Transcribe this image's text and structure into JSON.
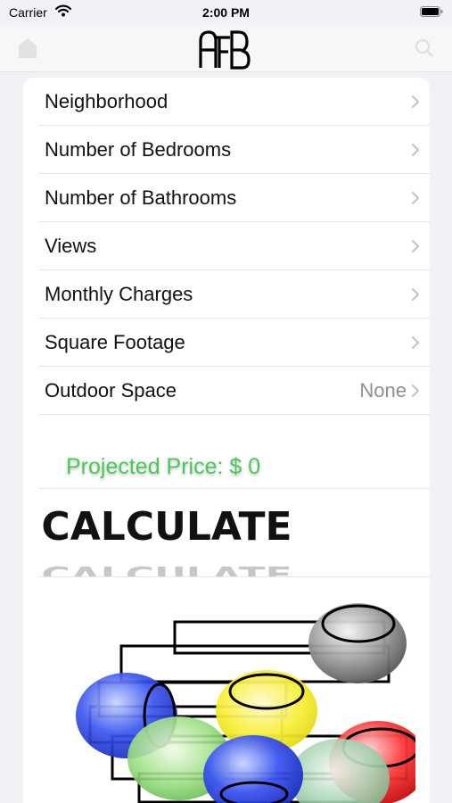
{
  "status_bar": {
    "carrier": "Carrier",
    "time": "2:00 PM",
    "icons": [
      "wifi-icon",
      "battery-icon"
    ]
  },
  "nav": {
    "logo_text": "AFB",
    "icons": [
      "home-icon",
      "search-icon"
    ]
  },
  "rows": [
    {
      "label": "Neighborhood",
      "value": ""
    },
    {
      "label": "Number of Bedrooms",
      "value": ""
    },
    {
      "label": "Number of Bathrooms",
      "value": ""
    },
    {
      "label": "Views",
      "value": ""
    },
    {
      "label": "Monthly Charges",
      "value": ""
    },
    {
      "label": "Square Footage",
      "value": ""
    },
    {
      "label": "Outdoor Space",
      "value": "None"
    }
  ],
  "price": {
    "label": "Projected Price: $ 0"
  },
  "calculate": {
    "label": "CALCULATE"
  },
  "colors": {
    "price_green": "#4cc85a",
    "background": "#f2f2f6",
    "separator": "#e5e5ea",
    "secondary_text": "#8e8e93"
  }
}
